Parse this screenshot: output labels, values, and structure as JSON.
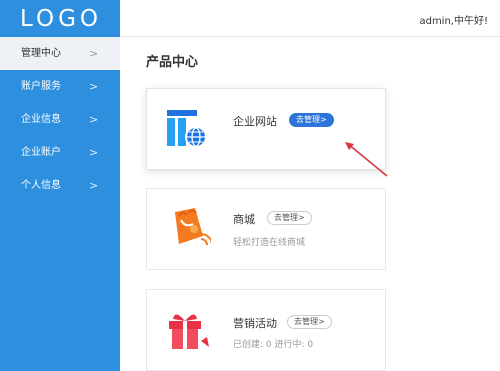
{
  "brand": {
    "logo_text": "LOGO"
  },
  "header": {
    "greeting": "admin,中午好!"
  },
  "sidebar": {
    "items": [
      {
        "label": "管理中心",
        "icon": "chevron-right-icon",
        "active": true
      },
      {
        "label": "账户服务",
        "icon": "chevron-right-icon",
        "active": false
      },
      {
        "label": "企业信息",
        "icon": "chevron-right-icon",
        "active": false
      },
      {
        "label": "企业账户",
        "icon": "chevron-right-icon",
        "active": false
      },
      {
        "label": "个人信息",
        "icon": "chevron-right-icon",
        "active": false
      }
    ],
    "chevron": ">"
  },
  "main": {
    "title": "产品中心",
    "cards": [
      {
        "name": "企业网站",
        "button": "去管理>",
        "icon": "website-icon",
        "description": ""
      },
      {
        "name": "商城",
        "button": "去管理>",
        "icon": "shopping-bag-icon",
        "description": "轻松打造在线商城"
      },
      {
        "name": "营销活动",
        "button": "去管理>",
        "icon": "gift-icon",
        "description": "已创建: 0   进行中: 0"
      }
    ]
  },
  "colors": {
    "sidebar": "#2d8fde",
    "primary_button": "#2d74d9",
    "arrow": "#d9333f"
  }
}
